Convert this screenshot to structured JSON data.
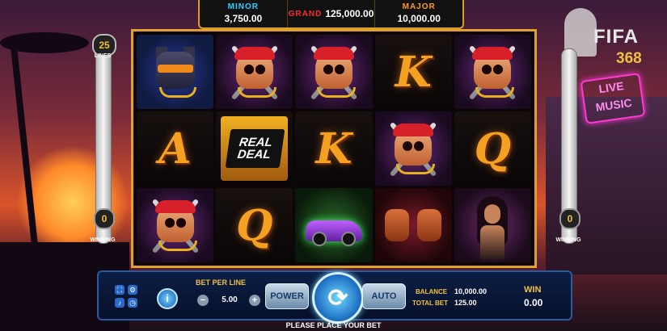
{
  "jackpots": [
    {
      "title": "MINOR",
      "value": "3,750.00"
    },
    {
      "title": "GRAND",
      "value": "125,000.00"
    },
    {
      "title": "MAJOR",
      "value": "10,000.00"
    }
  ],
  "meters": {
    "lines_count": "25",
    "lines_label": "LINES",
    "winning_label": "WINNING",
    "winning_value": "0"
  },
  "logo": {
    "name": "FIFA",
    "number": "368"
  },
  "neon_sign": "LIVE MUSIC",
  "reels": [
    [
      "dog",
      "skull",
      "skull",
      "K",
      "skull"
    ],
    [
      "A",
      "REAL DEAL",
      "K",
      "skull",
      "Q"
    ],
    [
      "skull",
      "Q",
      "car",
      "fists",
      "girl"
    ]
  ],
  "symbols": {
    "A": "A",
    "K": "K",
    "Q": "Q",
    "real_deal": "REAL DEAL"
  },
  "controls": {
    "bet_per_line_label": "BET PER LINE",
    "bet_per_line_value": "5.00",
    "minus": "−",
    "plus": "+",
    "power_label": "POWER",
    "auto_label": "AUTO",
    "info": "i",
    "spin_icon": "⟳"
  },
  "stats": {
    "balance_label": "BALANCE",
    "balance_value": "10,000.00",
    "total_bet_label": "TOTAL BET",
    "total_bet_value": "125.00",
    "win_label": "WIN",
    "win_value": "0.00"
  },
  "status_text": "PLEASE PLACE YOUR BET",
  "colors": {
    "accent": "#f2c040",
    "panel": "#0c1e45",
    "frame": "#e2a030"
  }
}
